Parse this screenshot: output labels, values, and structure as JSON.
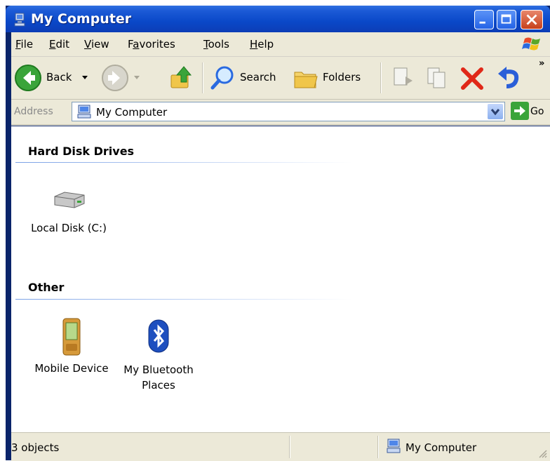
{
  "window": {
    "title": "My Computer"
  },
  "menu": {
    "items": [
      {
        "label": "File",
        "underline": "F",
        "rest": "ile"
      },
      {
        "label": "Edit",
        "underline": "E",
        "rest": "dit"
      },
      {
        "label": "View",
        "underline": "V",
        "rest": "iew"
      },
      {
        "label": "Favorites",
        "underline": "a",
        "pre": "F",
        "rest": "vorites"
      },
      {
        "label": "Tools",
        "underline": "T",
        "rest": "ools"
      },
      {
        "label": "Help",
        "underline": "H",
        "rest": "elp"
      }
    ]
  },
  "toolbar": {
    "back_label": "Back",
    "search_label": "Search",
    "folders_label": "Folders",
    "overflow": "»"
  },
  "address": {
    "label": "Address",
    "value": "My Computer",
    "go_label": "Go"
  },
  "groups": [
    {
      "title": "Hard Disk Drives",
      "items": [
        {
          "label": "Local Disk (C:)",
          "icon": "hard-disk-icon"
        }
      ]
    },
    {
      "title": "Other",
      "items": [
        {
          "label": "Mobile Device",
          "icon": "mobile-device-icon"
        },
        {
          "label": "My Bluetooth Places",
          "icon": "bluetooth-icon"
        }
      ]
    }
  ],
  "status": {
    "count_text": "3 objects",
    "location_text": "My Computer"
  },
  "colors": {
    "titlebar": "#0a48c8",
    "chrome": "#ece9d8",
    "close_button": "#c7401b",
    "group_line": "#7aa1e6"
  }
}
